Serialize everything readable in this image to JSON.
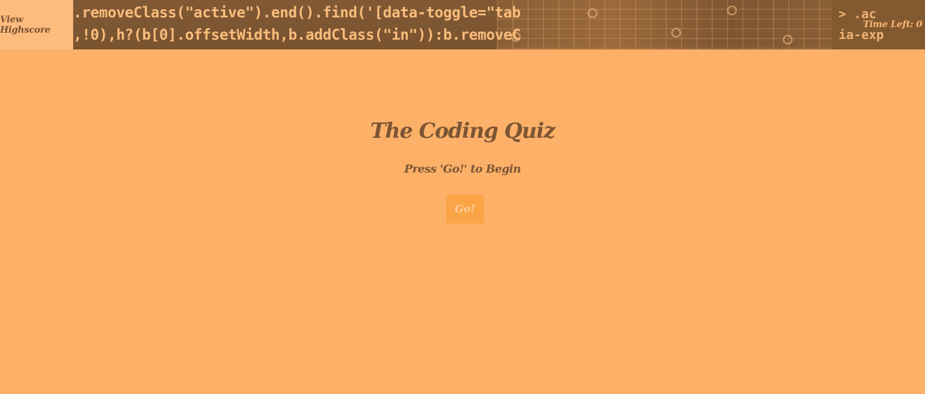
{
  "header": {
    "highscore_label": "View Highscore",
    "timer_label": "Time Left: 0",
    "banner_code": {
      "line1": ".removeClass(\"active\").end().find('[data-toggle=\"tab",
      "line2": ",!0),h?(b[0].offsetWidth,b.addClass(\"in\")):b.removeC",
      "right1": "> .ac",
      "right2": "ia-exp"
    }
  },
  "quiz": {
    "title": "The Coding Quiz",
    "subtitle": "Press 'Go!' to Begin",
    "start_label": "Go!"
  },
  "colors": {
    "page_background": "#fcb068",
    "text_brown": "#7b5534",
    "button_orange": "#fba446"
  }
}
